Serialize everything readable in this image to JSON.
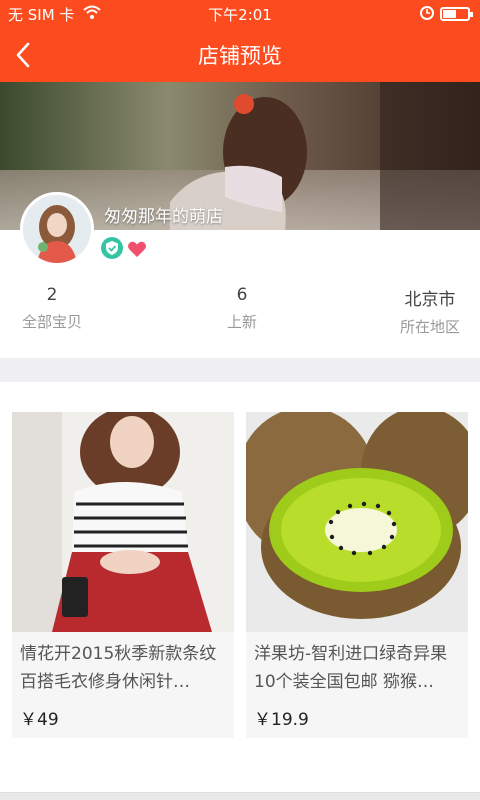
{
  "status_bar": {
    "carrier": "无 SIM 卡",
    "time": "下午2:01",
    "battery_level": 0.55,
    "icons": [
      "wifi-icon",
      "alarm-icon",
      "battery-icon"
    ]
  },
  "header": {
    "title": "店铺预览",
    "back_icon": "chevron-left-icon"
  },
  "shop": {
    "name": "匆匆那年的萌店",
    "badges": [
      "verified-shield-icon",
      "heart-icon"
    ]
  },
  "stats": [
    {
      "value": "2",
      "label": "全部宝贝"
    },
    {
      "value": "6",
      "label": "上新"
    },
    {
      "value": "北京市",
      "label": "所在地区"
    }
  ],
  "products": [
    {
      "name": "情花开2015秋季新款条纹百搭毛衣修身休闲针…",
      "price": "￥49"
    },
    {
      "name": "洋果坊-智利进口绿奇异果10个装全国包邮 猕猴…",
      "price": "￥19.9"
    }
  ],
  "colors": {
    "brand": "#fc4c1f",
    "verified": "#36c5a4",
    "heart": "#f0506e"
  }
}
